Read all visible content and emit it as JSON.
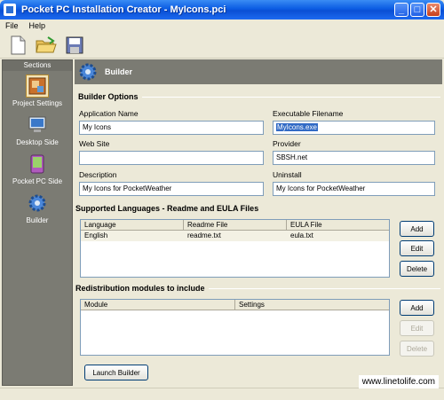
{
  "window": {
    "title": "Pocket PC Installation Creator - MyIcons.pci"
  },
  "menu": {
    "file": "File",
    "help": "Help"
  },
  "sidebar": {
    "header": "Sections",
    "items": [
      {
        "label": "Project Settings",
        "icon": "project-settings-icon"
      },
      {
        "label": "Desktop Side",
        "icon": "desktop-icon"
      },
      {
        "label": "Pocket PC Side",
        "icon": "pocket-pc-icon"
      },
      {
        "label": "Builder",
        "icon": "gear-icon"
      }
    ]
  },
  "main": {
    "header": "Builder",
    "builder_options": {
      "title": "Builder Options",
      "application_name": {
        "label": "Application Name",
        "value": "My Icons"
      },
      "executable_filename": {
        "label": "Executable Filename",
        "value": "MyIcons.exe"
      },
      "web_site": {
        "label": "Web Site",
        "value": ""
      },
      "provider": {
        "label": "Provider",
        "value": "SBSH.net"
      },
      "description": {
        "label": "Description",
        "value": "My Icons for PocketWeather"
      },
      "uninstall": {
        "label": "Uninstall",
        "value": "My Icons for PocketWeather"
      }
    },
    "languages": {
      "title": "Supported Languages - Readme and EULA Files",
      "columns": [
        "Language",
        "Readme File",
        "EULA File"
      ],
      "rows": [
        {
          "language": "English",
          "readme": "readme.txt",
          "eula": "eula.txt"
        }
      ],
      "add": "Add",
      "edit": "Edit",
      "delete": "Delete"
    },
    "redistribution": {
      "title": "Redistribution modules to include",
      "columns": [
        "Module",
        "Settings"
      ],
      "add": "Add",
      "edit": "Edit",
      "delete": "Delete"
    },
    "launch_builder": "Launch Builder"
  },
  "watermark": "www.linetolife.com"
}
